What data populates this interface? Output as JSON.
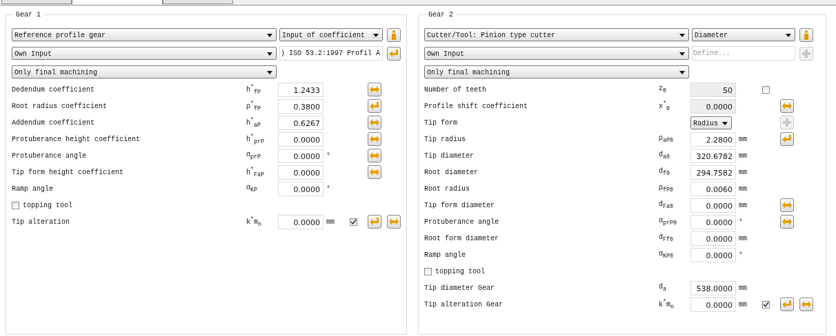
{
  "tabs": [
    {
      "selected": false
    },
    {
      "selected": true
    },
    {
      "selected": false
    }
  ],
  "panels": [
    {
      "title": "Gear 1",
      "selectors": [
        {
          "value": "Reference profile gear",
          "side": {
            "kind": "dropdown",
            "value": "Input of coefficient"
          },
          "button": {
            "kind": "info",
            "disabled": false
          }
        },
        {
          "value": "Own Input",
          "side": {
            "kind": "field",
            "value": ") ISO 53.2:1997 Profil A"
          },
          "button": {
            "kind": "enter",
            "disabled": false
          }
        },
        {
          "value": "Only final machining"
        }
      ],
      "rows": [
        {
          "kind": "value",
          "label": "Dedendum coefficient",
          "symbol": "h$^{*}$$_{fP}$",
          "value": "1.2433",
          "buttons": [
            {
              "kind": "swap",
              "disabled": false
            }
          ]
        },
        {
          "kind": "value",
          "label": "Root radius coefficient",
          "symbol": "ρ$^{*}$$_{fP}$",
          "value": "0.3800",
          "buttons": [
            {
              "kind": "enter",
              "disabled": false
            }
          ]
        },
        {
          "kind": "value",
          "label": "Addendum coefficient",
          "symbol": "h$^{*}$$_{aP}$",
          "value": "0.6267",
          "buttons": [
            {
              "kind": "swap",
              "disabled": false
            }
          ]
        },
        {
          "kind": "value",
          "label": "Protuberance height coefficient",
          "symbol": "h$^{*}$$_{prP}$",
          "value": "0.0000",
          "buttons": [
            {
              "kind": "swap",
              "disabled": false
            }
          ]
        },
        {
          "kind": "value",
          "label": "Protuberance angle",
          "symbol": "α$_{prP}$",
          "value": "0.0000",
          "unit": "°",
          "buttons": [
            {
              "kind": "swap",
              "disabled": false
            }
          ]
        },
        {
          "kind": "value",
          "label": "Tip form height coefficient",
          "symbol": "h$^{*}$$_{FaP}$",
          "value": "0.0000",
          "buttons": [
            {
              "kind": "swap",
              "disabled": false
            }
          ]
        },
        {
          "kind": "value",
          "label": "Ramp angle",
          "symbol": "α$_{KP}$",
          "value": "0.0000",
          "unit": "°"
        },
        {
          "kind": "checkbox",
          "label": "topping tool",
          "checked": false
        },
        {
          "kind": "value",
          "label": "Tip alteration",
          "symbol": "k$^{*}$m$_{n}$",
          "value": "0.0000",
          "unit": "mm",
          "checkbox": {
            "checked": true
          },
          "buttons": [
            {
              "kind": "enter",
              "disabled": false
            },
            {
              "kind": "swap",
              "disabled": false
            }
          ]
        }
      ]
    },
    {
      "title": "Gear 2",
      "selectors": [
        {
          "value": "Cutter/Tool: Pinion type cutter",
          "side": {
            "kind": "dropdown",
            "value": "Diameter"
          },
          "button": {
            "kind": "info",
            "disabled": false
          }
        },
        {
          "value": "Own Input",
          "side": {
            "kind": "field",
            "placeholder": "Define..."
          },
          "button": {
            "kind": "plus",
            "disabled": true
          }
        },
        {
          "value": "Only final machining"
        }
      ],
      "rows": [
        {
          "kind": "value",
          "label": "Number of teeth",
          "symbol": "z$_{0}$",
          "value": "50",
          "readonly": true,
          "checkbox": {
            "checked": false
          }
        },
        {
          "kind": "value",
          "label": "Profile shift coefficient",
          "symbol": "x$^{*}$$_{0}$",
          "value": "0.0000",
          "readonly": true,
          "buttons": [
            {
              "kind": "swap",
              "disabled": false
            }
          ]
        },
        {
          "kind": "dropdown",
          "label": "Tip form",
          "value": "Radius",
          "buttons": [
            {
              "kind": "plus",
              "disabled": true
            }
          ]
        },
        {
          "kind": "value",
          "label": "Tip radius",
          "symbol": "ρ$_{aP0}$",
          "value": "2.2800",
          "unit": "mm",
          "buttons": [
            {
              "kind": "enter",
              "disabled": false
            }
          ]
        },
        {
          "kind": "value",
          "label": "Tip diameter",
          "symbol": "d$_{a0}$",
          "value": "320.6782",
          "unit": "mm"
        },
        {
          "kind": "value",
          "label": "Root diameter",
          "symbol": "d$_{f0}$",
          "value": "294.7582",
          "unit": "mm"
        },
        {
          "kind": "value",
          "label": "Root radius",
          "symbol": "ρ$_{fP0}$",
          "value": "0.0060",
          "unit": "mm"
        },
        {
          "kind": "value",
          "label": "Tip form diameter",
          "symbol": "d$_{Fa0}$",
          "value": "0.0000",
          "unit": "mm",
          "buttons": [
            {
              "kind": "swap",
              "disabled": false
            }
          ]
        },
        {
          "kind": "value",
          "label": "Protuberance angle",
          "symbol": "α$_{prP0}$",
          "value": "0.0000",
          "unit": "°",
          "buttons": [
            {
              "kind": "swap",
              "disabled": false
            }
          ]
        },
        {
          "kind": "value",
          "label": "Root form diameter",
          "symbol": "d$_{Ff0}$",
          "value": "0.0000",
          "unit": "mm"
        },
        {
          "kind": "value",
          "label": "Ramp angle",
          "symbol": "α$_{KP0}$",
          "value": "0.0000",
          "unit": "°"
        },
        {
          "kind": "checkbox",
          "label": "topping tool",
          "checked": false
        },
        {
          "kind": "value",
          "label": "Tip diameter Gear",
          "symbol": "d$_{a}$",
          "value": "538.0000",
          "unit": "mm"
        },
        {
          "kind": "value",
          "label": "Tip alteration Gear",
          "symbol": "k$^{*}$m$_{n}$",
          "value": "0.0000",
          "unit": "mm",
          "checkbox": {
            "checked": true
          },
          "buttons": [
            {
              "kind": "enter",
              "disabled": false
            },
            {
              "kind": "swap",
              "disabled": false
            }
          ]
        }
      ]
    }
  ]
}
